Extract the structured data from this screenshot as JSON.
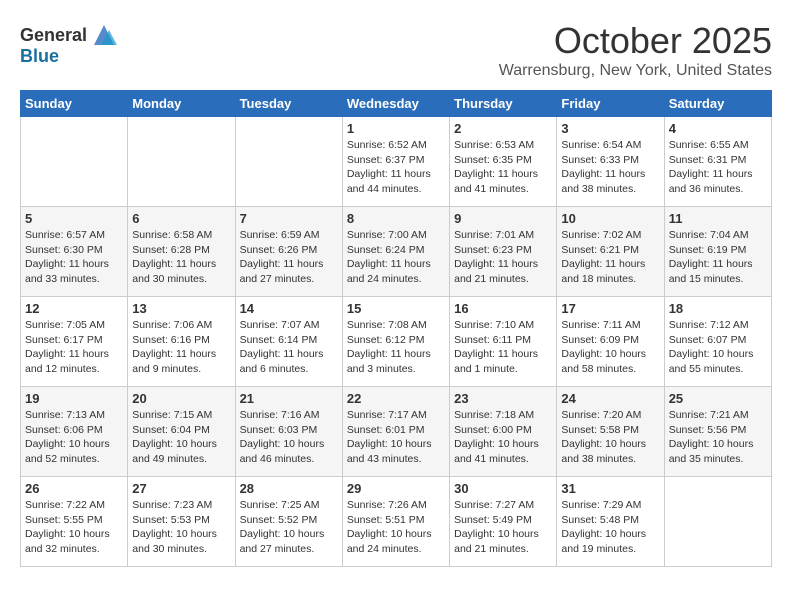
{
  "header": {
    "logo_general": "General",
    "logo_blue": "Blue",
    "month_title": "October 2025",
    "location": "Warrensburg, New York, United States"
  },
  "days_of_week": [
    "Sunday",
    "Monday",
    "Tuesday",
    "Wednesday",
    "Thursday",
    "Friday",
    "Saturday"
  ],
  "weeks": [
    [
      {
        "day": "",
        "info": ""
      },
      {
        "day": "",
        "info": ""
      },
      {
        "day": "",
        "info": ""
      },
      {
        "day": "1",
        "info": "Sunrise: 6:52 AM\nSunset: 6:37 PM\nDaylight: 11 hours and 44 minutes."
      },
      {
        "day": "2",
        "info": "Sunrise: 6:53 AM\nSunset: 6:35 PM\nDaylight: 11 hours and 41 minutes."
      },
      {
        "day": "3",
        "info": "Sunrise: 6:54 AM\nSunset: 6:33 PM\nDaylight: 11 hours and 38 minutes."
      },
      {
        "day": "4",
        "info": "Sunrise: 6:55 AM\nSunset: 6:31 PM\nDaylight: 11 hours and 36 minutes."
      }
    ],
    [
      {
        "day": "5",
        "info": "Sunrise: 6:57 AM\nSunset: 6:30 PM\nDaylight: 11 hours and 33 minutes."
      },
      {
        "day": "6",
        "info": "Sunrise: 6:58 AM\nSunset: 6:28 PM\nDaylight: 11 hours and 30 minutes."
      },
      {
        "day": "7",
        "info": "Sunrise: 6:59 AM\nSunset: 6:26 PM\nDaylight: 11 hours and 27 minutes."
      },
      {
        "day": "8",
        "info": "Sunrise: 7:00 AM\nSunset: 6:24 PM\nDaylight: 11 hours and 24 minutes."
      },
      {
        "day": "9",
        "info": "Sunrise: 7:01 AM\nSunset: 6:23 PM\nDaylight: 11 hours and 21 minutes."
      },
      {
        "day": "10",
        "info": "Sunrise: 7:02 AM\nSunset: 6:21 PM\nDaylight: 11 hours and 18 minutes."
      },
      {
        "day": "11",
        "info": "Sunrise: 7:04 AM\nSunset: 6:19 PM\nDaylight: 11 hours and 15 minutes."
      }
    ],
    [
      {
        "day": "12",
        "info": "Sunrise: 7:05 AM\nSunset: 6:17 PM\nDaylight: 11 hours and 12 minutes."
      },
      {
        "day": "13",
        "info": "Sunrise: 7:06 AM\nSunset: 6:16 PM\nDaylight: 11 hours and 9 minutes."
      },
      {
        "day": "14",
        "info": "Sunrise: 7:07 AM\nSunset: 6:14 PM\nDaylight: 11 hours and 6 minutes."
      },
      {
        "day": "15",
        "info": "Sunrise: 7:08 AM\nSunset: 6:12 PM\nDaylight: 11 hours and 3 minutes."
      },
      {
        "day": "16",
        "info": "Sunrise: 7:10 AM\nSunset: 6:11 PM\nDaylight: 11 hours and 1 minute."
      },
      {
        "day": "17",
        "info": "Sunrise: 7:11 AM\nSunset: 6:09 PM\nDaylight: 10 hours and 58 minutes."
      },
      {
        "day": "18",
        "info": "Sunrise: 7:12 AM\nSunset: 6:07 PM\nDaylight: 10 hours and 55 minutes."
      }
    ],
    [
      {
        "day": "19",
        "info": "Sunrise: 7:13 AM\nSunset: 6:06 PM\nDaylight: 10 hours and 52 minutes."
      },
      {
        "day": "20",
        "info": "Sunrise: 7:15 AM\nSunset: 6:04 PM\nDaylight: 10 hours and 49 minutes."
      },
      {
        "day": "21",
        "info": "Sunrise: 7:16 AM\nSunset: 6:03 PM\nDaylight: 10 hours and 46 minutes."
      },
      {
        "day": "22",
        "info": "Sunrise: 7:17 AM\nSunset: 6:01 PM\nDaylight: 10 hours and 43 minutes."
      },
      {
        "day": "23",
        "info": "Sunrise: 7:18 AM\nSunset: 6:00 PM\nDaylight: 10 hours and 41 minutes."
      },
      {
        "day": "24",
        "info": "Sunrise: 7:20 AM\nSunset: 5:58 PM\nDaylight: 10 hours and 38 minutes."
      },
      {
        "day": "25",
        "info": "Sunrise: 7:21 AM\nSunset: 5:56 PM\nDaylight: 10 hours and 35 minutes."
      }
    ],
    [
      {
        "day": "26",
        "info": "Sunrise: 7:22 AM\nSunset: 5:55 PM\nDaylight: 10 hours and 32 minutes."
      },
      {
        "day": "27",
        "info": "Sunrise: 7:23 AM\nSunset: 5:53 PM\nDaylight: 10 hours and 30 minutes."
      },
      {
        "day": "28",
        "info": "Sunrise: 7:25 AM\nSunset: 5:52 PM\nDaylight: 10 hours and 27 minutes."
      },
      {
        "day": "29",
        "info": "Sunrise: 7:26 AM\nSunset: 5:51 PM\nDaylight: 10 hours and 24 minutes."
      },
      {
        "day": "30",
        "info": "Sunrise: 7:27 AM\nSunset: 5:49 PM\nDaylight: 10 hours and 21 minutes."
      },
      {
        "day": "31",
        "info": "Sunrise: 7:29 AM\nSunset: 5:48 PM\nDaylight: 10 hours and 19 minutes."
      },
      {
        "day": "",
        "info": ""
      }
    ]
  ]
}
